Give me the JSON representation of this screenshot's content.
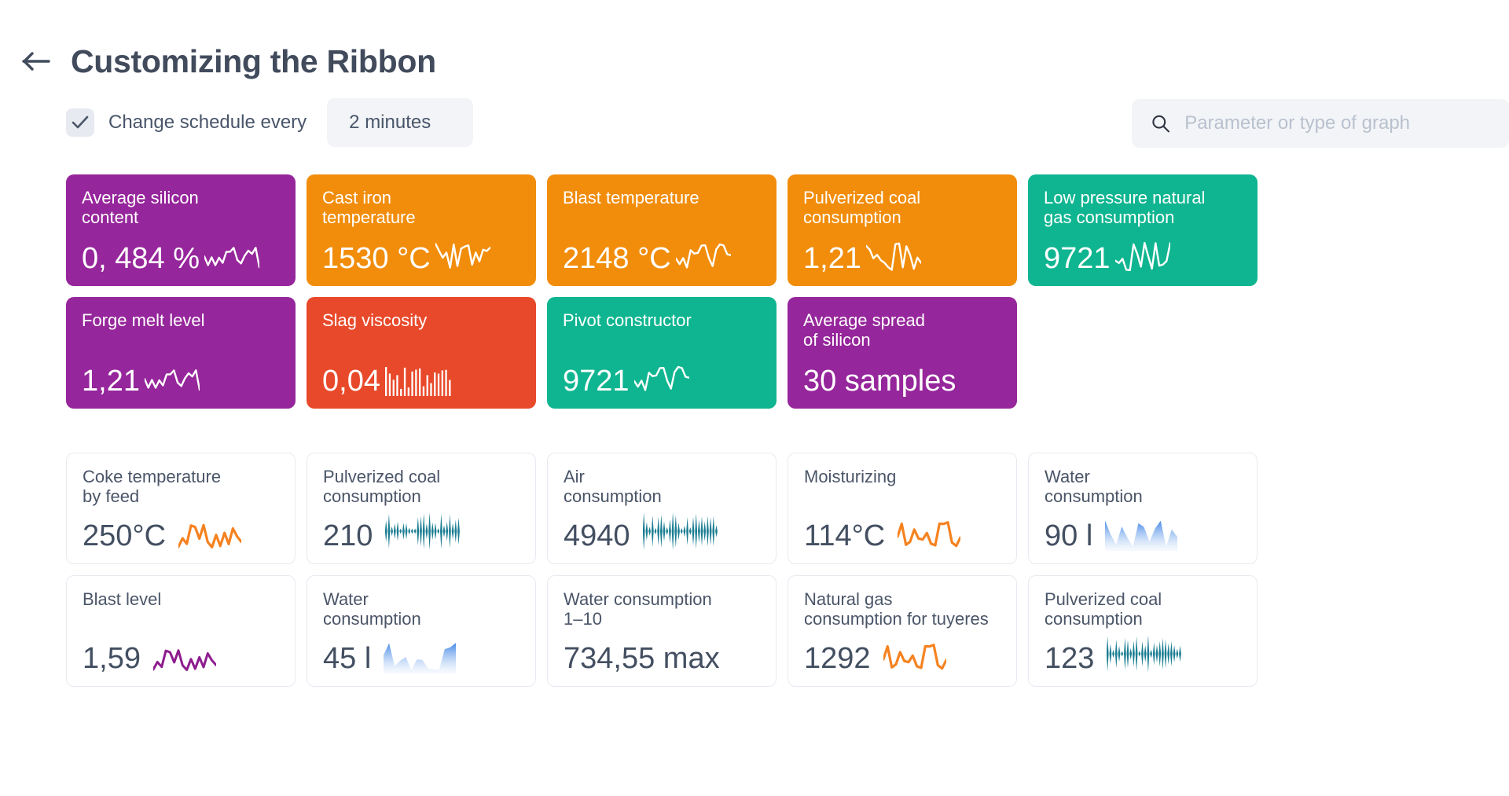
{
  "header": {
    "back_icon": "arrow-left-icon",
    "title": "Customizing the Ribbon"
  },
  "toolbar": {
    "checkbox_checked": true,
    "checkbox_icon": "check-icon",
    "check_label": "Change schedule every",
    "interval_value": "2 minutes",
    "search_icon": "search-icon",
    "search_placeholder": "Parameter or type of graph",
    "search_value": ""
  },
  "colors": {
    "purple": "#96269B",
    "orange": "#F18D0B",
    "red_orange": "#E8492A",
    "teal": "#0FB590",
    "text_dark": "#414B5C",
    "card_border": "#E7EAF0",
    "field_bg": "#F2F4F7",
    "spark_orange": "#F58220",
    "spark_teal": "#1C7E93",
    "spark_purple": "#8E1C8E",
    "spark_blue": "#4A90E2"
  },
  "colored_tiles_row1": [
    {
      "label": "Average silicon\ncontent",
      "value": "0, 484 %",
      "color": "purple",
      "spark": "line"
    },
    {
      "label": "Cast iron\ntemperature",
      "value": "1530 °C",
      "color": "orange",
      "spark": "line"
    },
    {
      "label": "Blast temperature",
      "value": "2148 °C",
      "color": "orange",
      "spark": "line"
    },
    {
      "label": "Pulverized coal\nconsumption",
      "value": "1,21",
      "color": "orange",
      "spark": "line"
    },
    {
      "label": "Low pressure natural\ngas consumption",
      "value": "9721",
      "color": "teal",
      "spark": "line"
    }
  ],
  "colored_tiles_row2": [
    {
      "label": "Forge melt level",
      "value": "1,21",
      "color": "purple",
      "spark": "line"
    },
    {
      "label": "Slag viscosity",
      "value": "0,04",
      "color": "red_orange",
      "spark": "bars"
    },
    {
      "label": "Pivot constructor",
      "value": "9721",
      "color": "teal",
      "spark": "line"
    },
    {
      "label": "Average spread\nof silicon",
      "value": "30 samples",
      "color": "purple",
      "spark": "none"
    }
  ],
  "plain_tiles_row1": [
    {
      "label": "Coke temperature\nby feed",
      "value": "250°C",
      "spark": "line-orange"
    },
    {
      "label": "Pulverized coal\nconsumption",
      "value": "210",
      "spark": "wave-teal"
    },
    {
      "label": "Air\nconsumption",
      "value": "4940",
      "spark": "wave-teal"
    },
    {
      "label": "Moisturizing",
      "value": "114°C",
      "spark": "line-orange"
    },
    {
      "label": "Water\nconsumption",
      "value": "90 l",
      "spark": "area-blue"
    }
  ],
  "plain_tiles_row2": [
    {
      "label": "Blast level",
      "value": "1,59",
      "spark": "line-purple"
    },
    {
      "label": "Water\nconsumption",
      "value": "45 l",
      "spark": "area-blue"
    },
    {
      "label": "Water consumption\n1–10",
      "value": "734,55 max",
      "spark": "none"
    },
    {
      "label": "Natural gas\nconsumption for tuyeres",
      "value": "1292",
      "spark": "line-orange"
    },
    {
      "label": "Pulverized coal\nconsumption",
      "value": "123",
      "spark": "wave-teal"
    }
  ]
}
